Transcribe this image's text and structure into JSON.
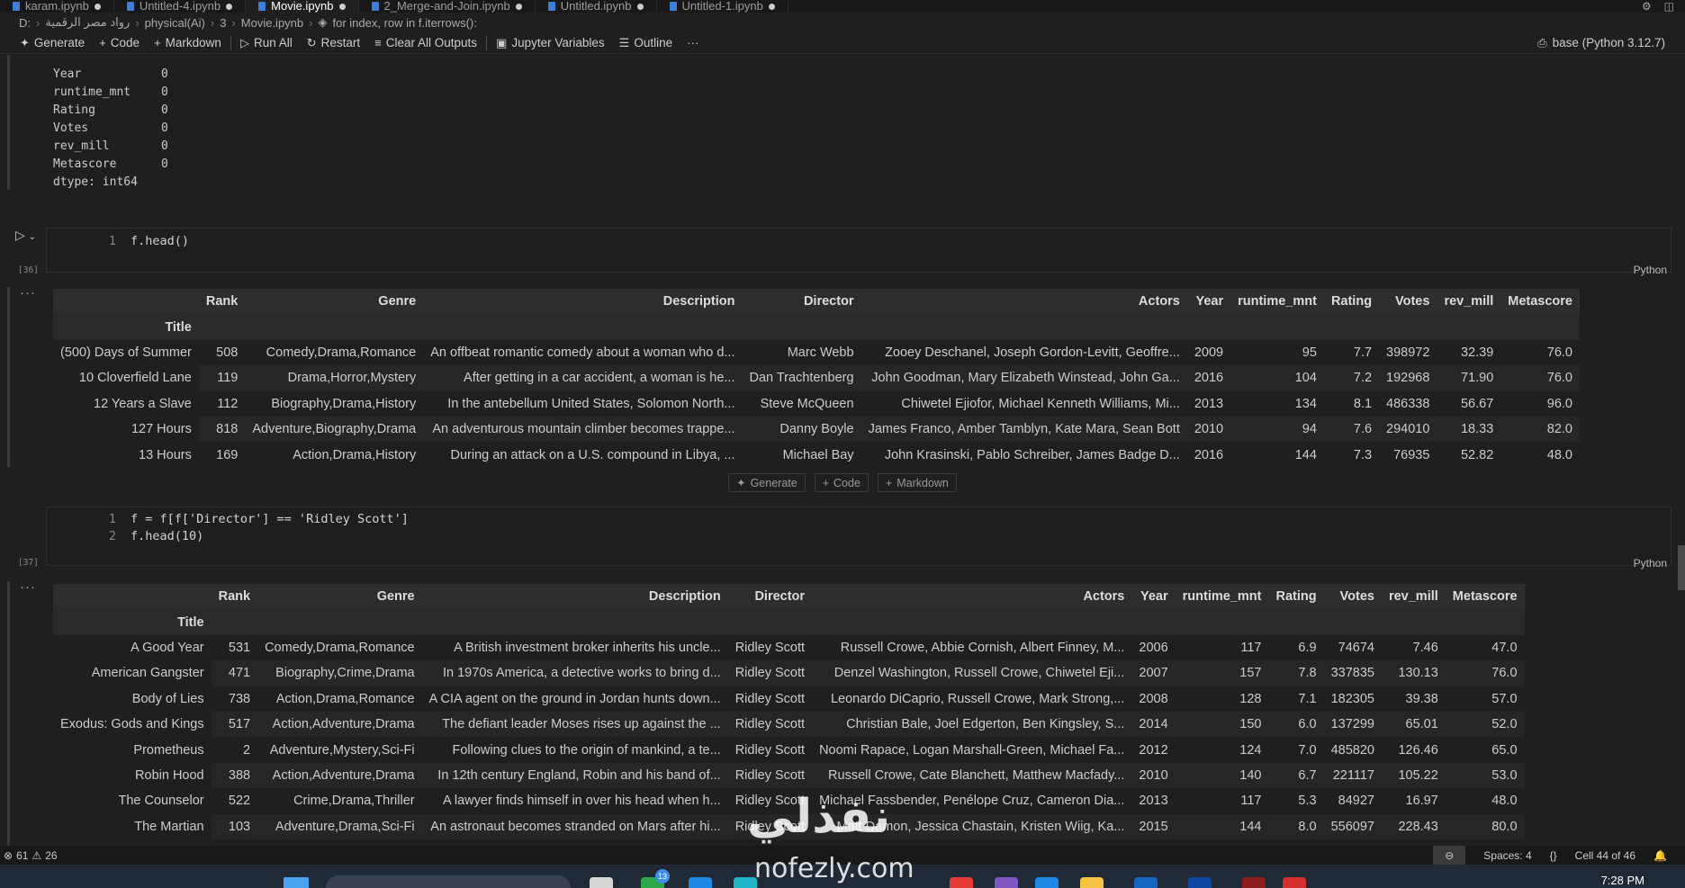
{
  "tabs": [
    {
      "label": "karam.ipynb",
      "active": false
    },
    {
      "label": "Untitled-4.ipynb",
      "active": false
    },
    {
      "label": "Movie.ipynb",
      "active": true
    },
    {
      "label": "2_Merge-and-Join.ipynb",
      "active": false
    },
    {
      "label": "Untitled.ipynb",
      "active": false
    },
    {
      "label": "Untitled-1.ipynb",
      "active": false
    }
  ],
  "breadcrumb": [
    "D:",
    "رواد مصر الرقمية",
    "physical(Ai)",
    "3",
    "Movie.ipynb",
    "for index, row in f.iterrows():"
  ],
  "toolbar": {
    "generate": "Generate",
    "code": "Code",
    "markdown": "Markdown",
    "run_all": "Run All",
    "restart": "Restart",
    "clear_outputs": "Clear All Outputs",
    "variables": "Jupyter Variables",
    "outline": "Outline",
    "more": "···",
    "kernel": "base (Python 3.12.7)"
  },
  "series_output": {
    "rows": [
      {
        "key": "Year",
        "value": "0"
      },
      {
        "key": "runtime_mnt",
        "value": "0"
      },
      {
        "key": "Rating",
        "value": "0"
      },
      {
        "key": "Votes",
        "value": "0"
      },
      {
        "key": "rev_mill",
        "value": "0"
      },
      {
        "key": "Metascore",
        "value": "0"
      }
    ],
    "dtype": "dtype: int64"
  },
  "cell36": {
    "exec_count": "[36]",
    "language": "Python",
    "lines": [
      {
        "num": "1",
        "code": "f.head()"
      }
    ],
    "table": {
      "columns": [
        "Rank",
        "Genre",
        "Description",
        "Director",
        "Actors",
        "Year",
        "runtime_mnt",
        "Rating",
        "Votes",
        "rev_mill",
        "Metascore"
      ],
      "index_name": "Title",
      "rows": [
        [
          "(500) Days of Summer",
          "508",
          "Comedy,Drama,Romance",
          "An offbeat romantic comedy about a woman who d...",
          "Marc Webb",
          "Zooey Deschanel, Joseph Gordon-Levitt, Geoffre...",
          "2009",
          "95",
          "7.7",
          "398972",
          "32.39",
          "76.0"
        ],
        [
          "10 Cloverfield Lane",
          "119",
          "Drama,Horror,Mystery",
          "After getting in a car accident, a woman is he...",
          "Dan Trachtenberg",
          "John Goodman, Mary Elizabeth Winstead, John Ga...",
          "2016",
          "104",
          "7.2",
          "192968",
          "71.90",
          "76.0"
        ],
        [
          "12 Years a Slave",
          "112",
          "Biography,Drama,History",
          "In the antebellum United States, Solomon North...",
          "Steve McQueen",
          "Chiwetel Ejiofor, Michael Kenneth Williams, Mi...",
          "2013",
          "134",
          "8.1",
          "486338",
          "56.67",
          "96.0"
        ],
        [
          "127 Hours",
          "818",
          "Adventure,Biography,Drama",
          "An adventurous mountain climber becomes trappe...",
          "Danny Boyle",
          "James Franco, Amber Tamblyn, Kate Mara, Sean Bott",
          "2010",
          "94",
          "7.6",
          "294010",
          "18.33",
          "82.0"
        ],
        [
          "13 Hours",
          "169",
          "Action,Drama,History",
          "During an attack on a U.S. compound in Libya, ...",
          "Michael Bay",
          "John Krasinski, Pablo Schreiber, James Badge D...",
          "2016",
          "144",
          "7.3",
          "76935",
          "52.82",
          "48.0"
        ]
      ]
    }
  },
  "add_cell": {
    "generate": "Generate",
    "code": "Code",
    "markdown": "Markdown"
  },
  "cell37": {
    "exec_count": "[37]",
    "language": "Python",
    "lines": [
      {
        "num": "1",
        "code": "f = f[f['Director'] == 'Ridley Scott']"
      },
      {
        "num": "2",
        "code": "f.head(10)"
      }
    ],
    "table": {
      "columns": [
        "Rank",
        "Genre",
        "Description",
        "Director",
        "Actors",
        "Year",
        "runtime_mnt",
        "Rating",
        "Votes",
        "rev_mill",
        "Metascore"
      ],
      "index_name": "Title",
      "rows": [
        [
          "A Good Year",
          "531",
          "Comedy,Drama,Romance",
          "A British investment broker inherits his uncle...",
          "Ridley Scott",
          "Russell Crowe, Abbie Cornish, Albert Finney, M...",
          "2006",
          "117",
          "6.9",
          "74674",
          "7.46",
          "47.0"
        ],
        [
          "American Gangster",
          "471",
          "Biography,Crime,Drama",
          "In 1970s America, a detective works to bring d...",
          "Ridley Scott",
          "Denzel Washington, Russell Crowe, Chiwetel Eji...",
          "2007",
          "157",
          "7.8",
          "337835",
          "130.13",
          "76.0"
        ],
        [
          "Body of Lies",
          "738",
          "Action,Drama,Romance",
          "A CIA agent on the ground in Jordan hunts down...",
          "Ridley Scott",
          "Leonardo DiCaprio, Russell Crowe, Mark Strong,...",
          "2008",
          "128",
          "7.1",
          "182305",
          "39.38",
          "57.0"
        ],
        [
          "Exodus: Gods and Kings",
          "517",
          "Action,Adventure,Drama",
          "The defiant leader Moses rises up against the ...",
          "Ridley Scott",
          "Christian Bale, Joel Edgerton, Ben Kingsley, S...",
          "2014",
          "150",
          "6.0",
          "137299",
          "65.01",
          "52.0"
        ],
        [
          "Prometheus",
          "2",
          "Adventure,Mystery,Sci-Fi",
          "Following clues to the origin of mankind, a te...",
          "Ridley Scott",
          "Noomi Rapace, Logan Marshall-Green, Michael Fa...",
          "2012",
          "124",
          "7.0",
          "485820",
          "126.46",
          "65.0"
        ],
        [
          "Robin Hood",
          "388",
          "Action,Adventure,Drama",
          "In 12th century England, Robin and his band of...",
          "Ridley Scott",
          "Russell Crowe, Cate Blanchett, Matthew Macfady...",
          "2010",
          "140",
          "6.7",
          "221117",
          "105.22",
          "53.0"
        ],
        [
          "The Counselor",
          "522",
          "Crime,Drama,Thriller",
          "A lawyer finds himself in over his head when h...",
          "Ridley Scott",
          "Michael Fassbender, Penélope Cruz, Cameron Dia...",
          "2013",
          "117",
          "5.3",
          "84927",
          "16.97",
          "48.0"
        ],
        [
          "The Martian",
          "103",
          "Adventure,Drama,Sci-Fi",
          "An astronaut becomes stranded on Mars after hi...",
          "Ridley Scott",
          "Matt Damon, Jessica Chastain, Kristen Wiig, Ka...",
          "2015",
          "144",
          "8.0",
          "556097",
          "228.43",
          "80.0"
        ]
      ]
    }
  },
  "status": {
    "errors": "61",
    "warnings": "26",
    "spaces": "Spaces: 4",
    "cell_pos": "Cell 44 of 46"
  },
  "taskbar": {
    "time": "7:28 PM",
    "badge": "13"
  },
  "watermark": {
    "logo": "نفذلي",
    "text": "nofezly.com"
  }
}
